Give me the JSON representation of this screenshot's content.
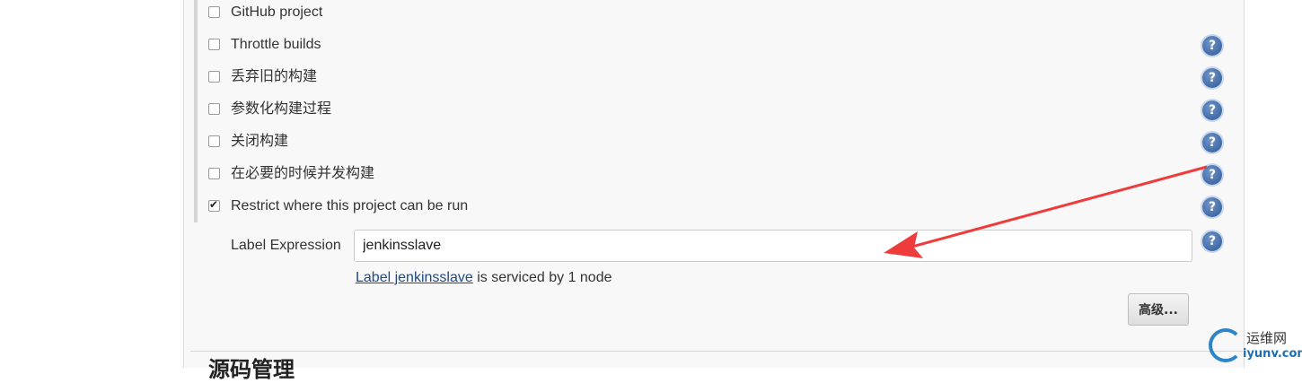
{
  "options": [
    {
      "label": "GitHub project",
      "checked": false,
      "has_help": false
    },
    {
      "label": "Throttle builds",
      "checked": false,
      "has_help": true
    },
    {
      "label": "丢弃旧的构建",
      "checked": false,
      "has_help": true
    },
    {
      "label": "参数化构建过程",
      "checked": false,
      "has_help": true
    },
    {
      "label": "关闭构建",
      "checked": false,
      "has_help": true
    },
    {
      "label": "在必要的时候并发构建",
      "checked": false,
      "has_help": true
    },
    {
      "label": "Restrict where this project can be run",
      "checked": true,
      "has_help": true
    }
  ],
  "help_icon": {
    "symbol": "?",
    "icon": "question-circle-icon",
    "color": "#3a68a8"
  },
  "label_expression": {
    "label": "Label Expression",
    "value": "jenkinsslave",
    "status_link": "Label jenkinsslave",
    "status_text": " is serviced by 1 node"
  },
  "advanced_button": "高级...",
  "next_section_title": "源码管理",
  "annotation_arrow_color": "#ee3b3b",
  "watermark": {
    "line1": "运维网",
    "line2": "iyunv.com"
  }
}
